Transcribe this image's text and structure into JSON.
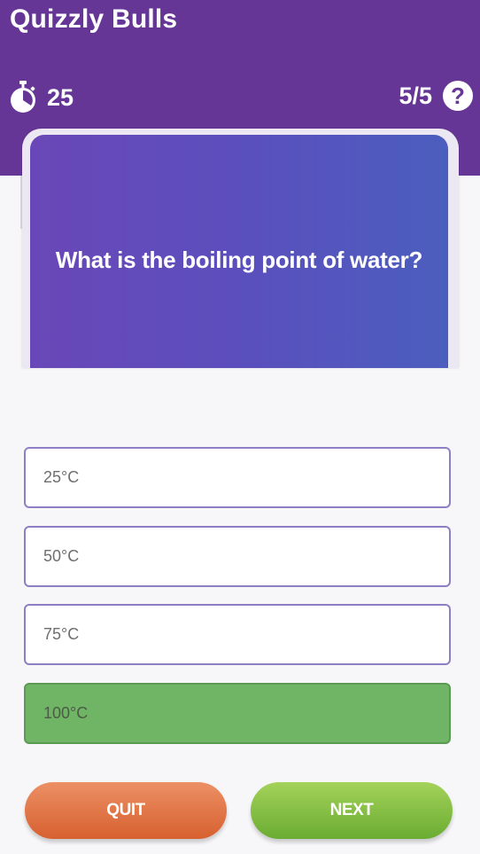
{
  "header": {
    "app_title": "Quizzly Bulls",
    "timer_icon": "stopwatch-icon",
    "timer_value": "25",
    "progress": "5/5",
    "help_icon": "help-icon",
    "help_glyph": "?",
    "background_color": "#663697"
  },
  "question": {
    "text": "What is the boiling point of water?"
  },
  "options": [
    {
      "label": "25°C",
      "selected": false
    },
    {
      "label": "50°C",
      "selected": false
    },
    {
      "label": "75°C",
      "selected": false
    },
    {
      "label": "100°C",
      "selected": true,
      "state": "correct"
    }
  ],
  "buttons": {
    "quit_label": "QUIT",
    "next_label": "NEXT"
  },
  "colors": {
    "correct": "#70b466",
    "option_border": "#8e7fc4",
    "quit": "#e07040",
    "next": "#8cc444"
  }
}
